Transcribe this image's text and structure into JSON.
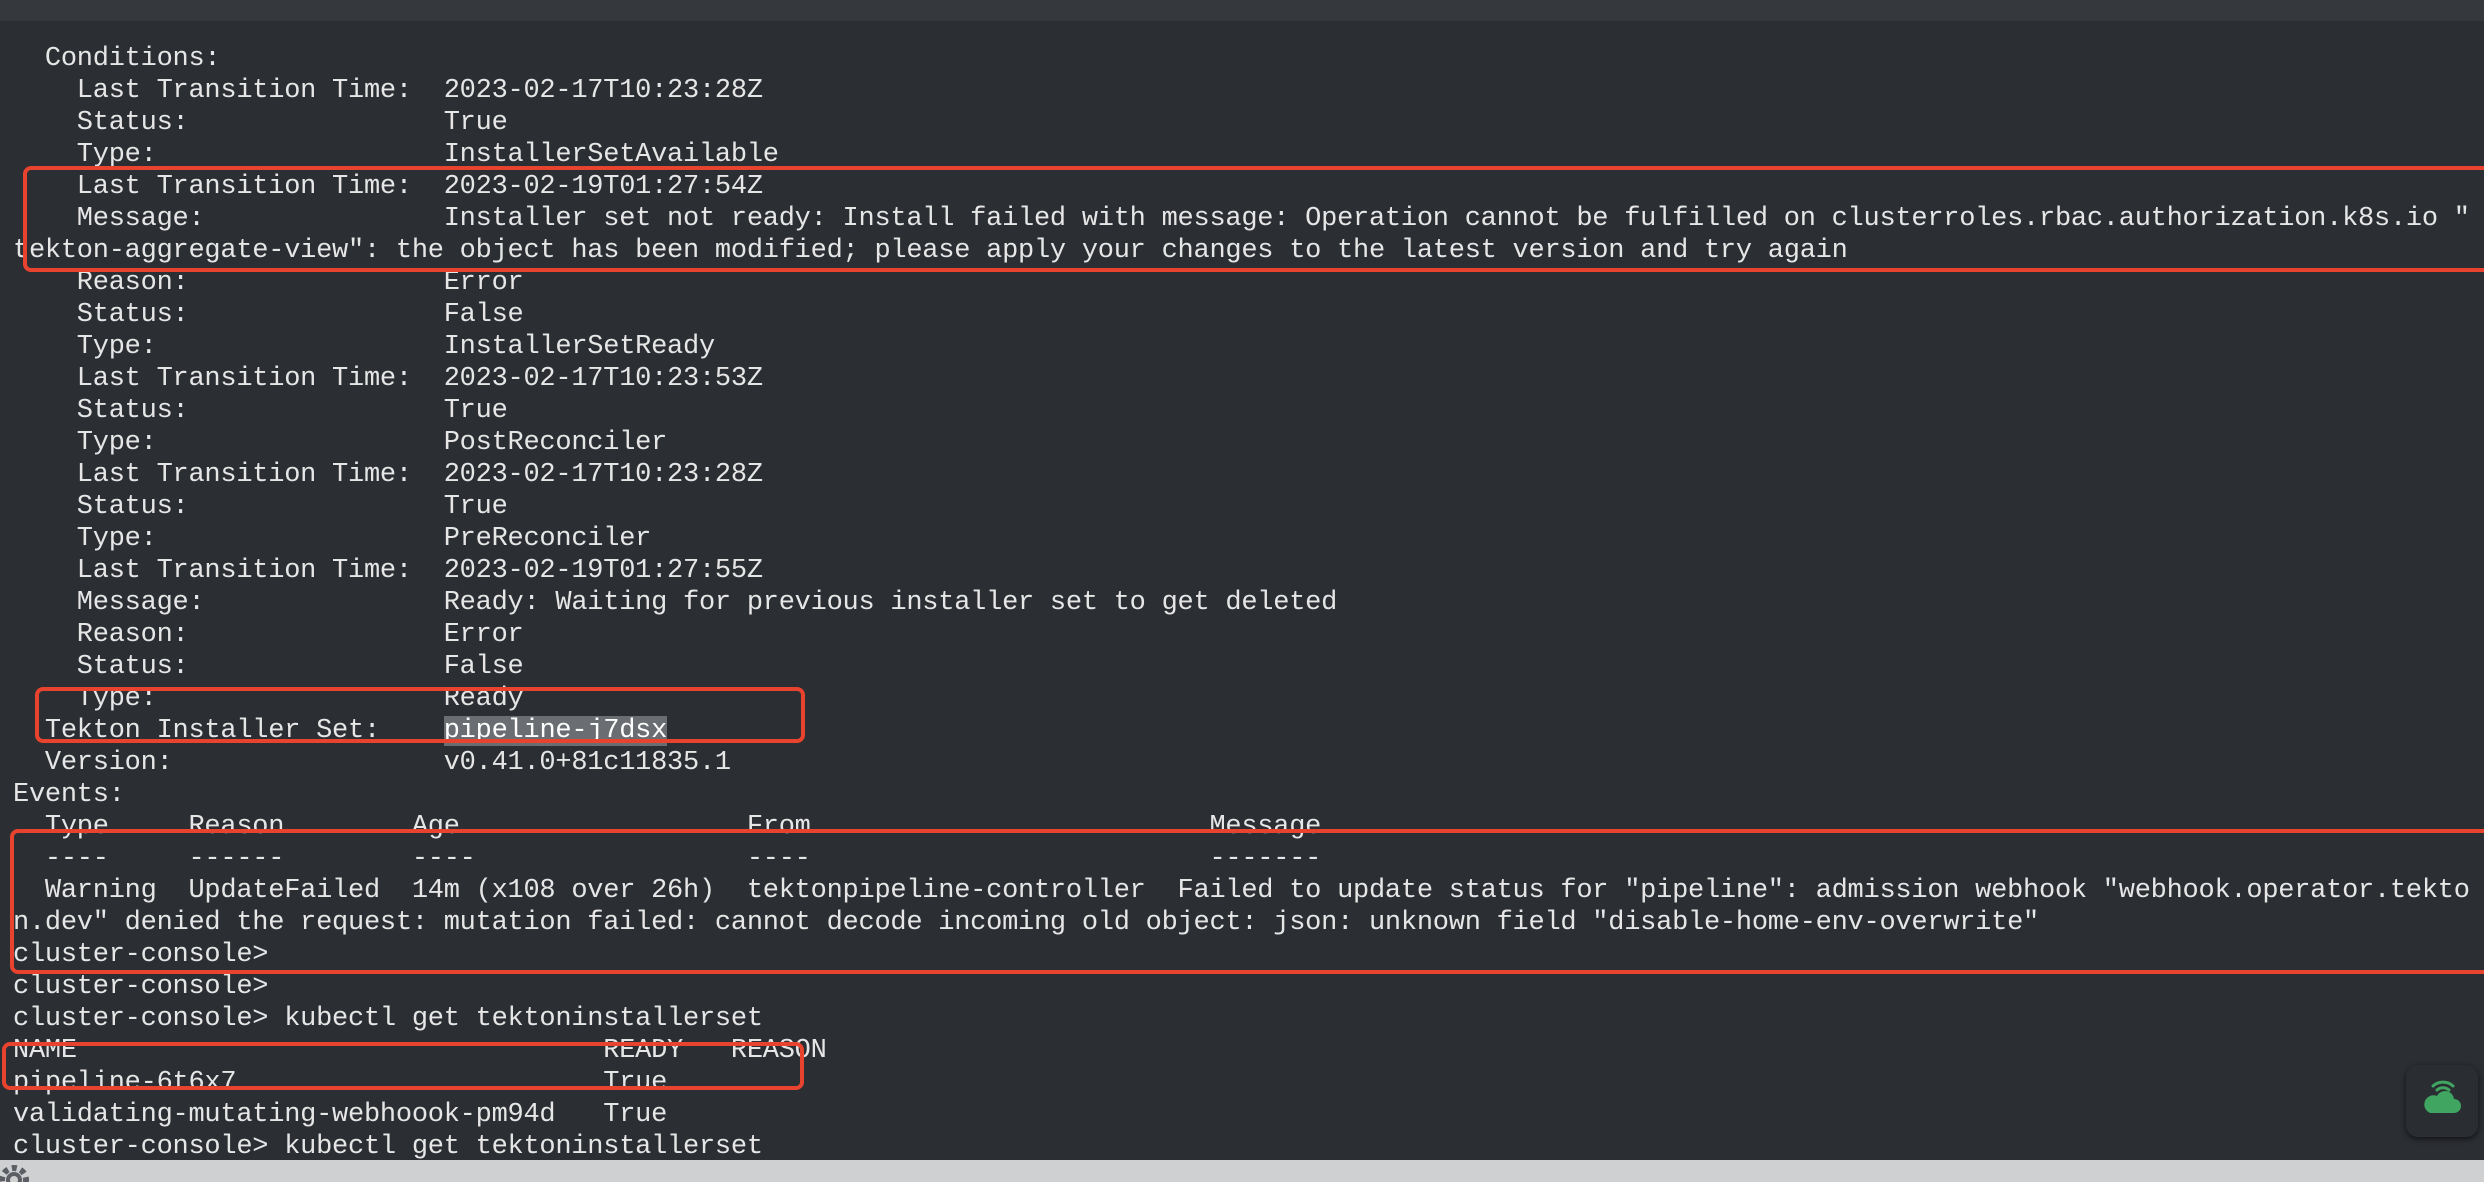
{
  "terminal": {
    "lines": [
      "  Conditions:",
      "    Last Transition Time:  2023-02-17T10:23:28Z",
      "    Status:                True",
      "    Type:                  InstallerSetAvailable",
      "    Last Transition Time:  2023-02-19T01:27:54Z",
      "    Message:               Installer set not ready: Install failed with message: Operation cannot be fulfilled on clusterroles.rbac.authorization.k8s.io \"",
      "tekton-aggregate-view\": the object has been modified; please apply your changes to the latest version and try again",
      "    Reason:                Error",
      "    Status:                False",
      "    Type:                  InstallerSetReady",
      "    Last Transition Time:  2023-02-17T10:23:53Z",
      "    Status:                True",
      "    Type:                  PostReconciler",
      "    Last Transition Time:  2023-02-17T10:23:28Z",
      "    Status:                True",
      "    Type:                  PreReconciler",
      "    Last Transition Time:  2023-02-19T01:27:55Z",
      "    Message:               Ready: Waiting for previous installer set to get deleted",
      "    Reason:                Error",
      "    Status:                False",
      "    Type:                  Ready",
      "  Tekton Installer Set:    ",
      "  Version:                 v0.41.0+81c11835.1",
      "Events:",
      "  Type     Reason        Age                  From                         Message",
      "  ----     ------        ----                 ----                         -------",
      "  Warning  UpdateFailed  14m (x108 over 26h)  tektonpipeline-controller  Failed to update status for \"pipeline\": admission webhook \"webhook.operator.tekto",
      "n.dev\" denied the request: mutation failed: cannot decode incoming old object: json: unknown field \"disable-home-env-overwrite\"",
      "cluster-console>",
      "cluster-console>",
      "cluster-console> kubectl get tektoninstallerset",
      "NAME                                 READY   REASON",
      "pipeline-6t6x7                       True",
      "validating-mutating-webhoook-pm94d   True",
      "cluster-console> kubectl get tektoninstallerset"
    ],
    "selected_text": "pipeline-j7dsx",
    "selected_line_index": 21
  },
  "icons": {
    "floating_button": "cloud-signal-icon",
    "corner": "gear-icon"
  },
  "colors": {
    "background": "#2b2e33",
    "text": "#e6e6e6",
    "highlight_box": "#e8432e",
    "selection": "#6a6d72",
    "cloud_icon": "#3fa560"
  }
}
